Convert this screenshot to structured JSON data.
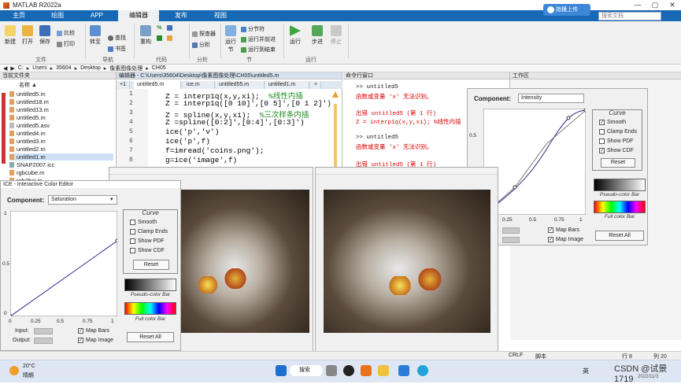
{
  "window": {
    "title": "MATLAB R2022a",
    "minimize": "—",
    "maximize": "▢",
    "close": "✕"
  },
  "tabs": [
    "主页",
    "绘图",
    "APP",
    "编辑器",
    "发布",
    "视图"
  ],
  "account_button": "指播上传",
  "search_placeholder": "搜索文档",
  "ribbon": {
    "file_group": "文件",
    "nav_group": "导航",
    "code_group": "代码",
    "analyze_group": "分析",
    "section_group": "节",
    "run_group": "运行",
    "new": "新建",
    "open": "打开",
    "save": "保存",
    "compare": "比较",
    "print": "打印",
    "goto": "转至",
    "find": "查找",
    "bookmark": "书签",
    "refactor": "重构",
    "profiler": "探查器",
    "analyze": "分析",
    "run_section": "运行节",
    "section_break": "分节符",
    "run_and_advance": "运行并前进",
    "run_to_end": "运行到结束",
    "run": "运行",
    "step": "步进",
    "stop": "停止"
  },
  "address": {
    "drive": "C:",
    "parts": [
      "Users",
      "35604",
      "Desktop",
      "像素图像处理",
      "CH05"
    ]
  },
  "file_panel": {
    "title": "当前文件夹",
    "col": "名称 ▲",
    "files": [
      "untitled5.m",
      "untitled18.m",
      "untitled13.m",
      "untitled5.m",
      "untitled5.asv",
      "untitled4.m",
      "untitled3.m",
      "untitled2.m",
      "untitled1.m",
      "SNAP2007.icc",
      "rgbcube.m",
      "rgb2hsi.m",
      "ICE - Interactive Color Editor"
    ]
  },
  "editor": {
    "title": "编辑器 - C:\\Users\\35604\\Desktop\\像素图像处理\\CH05\\untitled5.m",
    "tabs": [
      "+1",
      "untitled5.m",
      "ice.m",
      "untitled55.m",
      "untitled1.m",
      "+"
    ],
    "line_numbers": [
      "1",
      "2",
      "3",
      "4",
      "5",
      "6",
      "7",
      "8"
    ],
    "lines": [
      {
        "code": "Z = interp1q(x,y,xi);",
        "comment": "%线性内插"
      },
      {
        "code": "Z = interp1q([0 10]',[0 5]',[0 1 2]')",
        "comment": ""
      },
      {
        "code": "Z = spline(x,y,xi);",
        "comment": "%三次样条内插"
      },
      {
        "code": "Z =spline([0:2]',[0:4]',[0:3]')",
        "comment": ""
      },
      {
        "code": "ice('p','v')",
        "comment": ""
      },
      {
        "code": "ice('p',f)",
        "comment": ""
      },
      {
        "code": "f=imread('coins.png');",
        "comment": ""
      },
      {
        "code": "g=ice('image',f)",
        "comment": ""
      }
    ]
  },
  "command_window": {
    "title": "命令行窗口",
    "lines": [
      {
        "t": ">> untitled5",
        "c": "normal"
      },
      {
        "t": "函数或变量 'x' 无法识别。",
        "c": "err"
      },
      {
        "t": "",
        "c": "normal"
      },
      {
        "t": "出错 untitled5 (第 1 行)",
        "c": "err"
      },
      {
        "t": "Z = interp1q(x,y,xi);   %线性内插",
        "c": "err"
      },
      {
        "t": "",
        "c": "normal"
      },
      {
        "t": ">> untitled5",
        "c": "normal"
      },
      {
        "t": "函数或变量 'x' 无法识别。",
        "c": "err"
      },
      {
        "t": "",
        "c": "normal"
      },
      {
        "t": "出错 untitled5 (第 1 行)",
        "c": "err"
      }
    ]
  },
  "workspace": {
    "title": "工作区"
  },
  "ice_left": {
    "component_label": "Component:",
    "component_value": "Saturation",
    "curve_title": "Curve",
    "checks": [
      {
        "label": "Smooth",
        "checked": false
      },
      {
        "label": "Clamp Ends",
        "checked": false
      },
      {
        "label": "Show PDF",
        "checked": false
      },
      {
        "label": "Show CDF",
        "checked": false
      }
    ],
    "reset": "Reset",
    "pseudo": "Pseudo-color Bar",
    "full": "Full color Bar",
    "reset_all": "Reset All",
    "ticks": [
      "0",
      "0.25",
      "0.5",
      "0.75",
      "1"
    ],
    "yticks": [
      "1",
      "0.5",
      "0"
    ],
    "input": "Input:",
    "output": "Output:",
    "map_bars": "Map Bars",
    "map_image": "Map Image"
  },
  "ice_right": {
    "component_label": "Component:",
    "component_value": "Intensity",
    "curve_title": "Curve",
    "checks": [
      {
        "label": "Smooth",
        "checked": true
      },
      {
        "label": "Clamp Ends",
        "checked": false
      },
      {
        "label": "Show PDF",
        "checked": false
      },
      {
        "label": "Show CDF",
        "checked": true
      }
    ],
    "reset": "Reset",
    "pseudo": "Pseudo-color Bar",
    "full": "Full color Bar",
    "reset_all": "Reset All",
    "ticks": [
      "0.25",
      "0.5",
      "0.75",
      "1"
    ],
    "yticks": [
      "0.5"
    ],
    "map_bars": "Map Bars",
    "map_image": "Map Image"
  },
  "status": {
    "encoding": "CRLF",
    "script": "脚本",
    "ln": "行 8",
    "col": "列 20"
  },
  "taskbar": {
    "temp": "20°C",
    "weather": "晴朗",
    "search": "搜索",
    "ime": "英",
    "date": "2022/11/3",
    "watermark": "CSDN @试景1719"
  }
}
